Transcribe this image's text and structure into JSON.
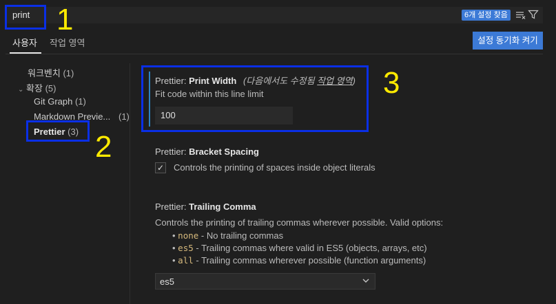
{
  "search": {
    "query": "print",
    "result_count": "6개 설정 찾음"
  },
  "tabs": {
    "user": "사용자",
    "workspace": "작업 영역"
  },
  "sync_button": "설정 동기화 켜기",
  "sidebar": {
    "workbench": {
      "label": "워크벤치",
      "count": "(1)"
    },
    "extensions": {
      "label": "확장",
      "count": "(5)"
    },
    "git_graph": {
      "label": "Git Graph",
      "count": "(1)"
    },
    "markdown_preview": {
      "label": "Markdown Previe...",
      "count": "(1)"
    },
    "prettier": {
      "label": "Prettier",
      "count": "(3)"
    }
  },
  "settings": {
    "print_width": {
      "category": "Prettier: ",
      "name": "Print Width",
      "modified_note": "(다음에서도 수정됨 ",
      "modified_link": "작업 영역",
      "modified_close": ")",
      "description": "Fit code within this line limit",
      "value": "100"
    },
    "bracket_spacing": {
      "category": "Prettier: ",
      "name": "Bracket Spacing",
      "description": "Controls the printing of spaces inside object literals",
      "checked": true
    },
    "trailing_comma": {
      "category": "Prettier: ",
      "name": "Trailing Comma",
      "description": "Controls the printing of trailing commas wherever possible. Valid options:",
      "options": [
        {
          "code": "none",
          "text": " - No trailing commas"
        },
        {
          "code": "es5",
          "text": " - Trailing commas where valid in ES5 (objects, arrays, etc)"
        },
        {
          "code": "all",
          "text": " - Trailing commas wherever possible (function arguments)"
        }
      ],
      "value": "es5"
    }
  },
  "annotations": {
    "one": "1",
    "two": "2",
    "three": "3"
  },
  "colors": {
    "accent": "#3c7ad6",
    "annotation_box": "#0a2fe6",
    "annotation_number": "#ffea00",
    "modified_bar": "#2b84c6"
  }
}
